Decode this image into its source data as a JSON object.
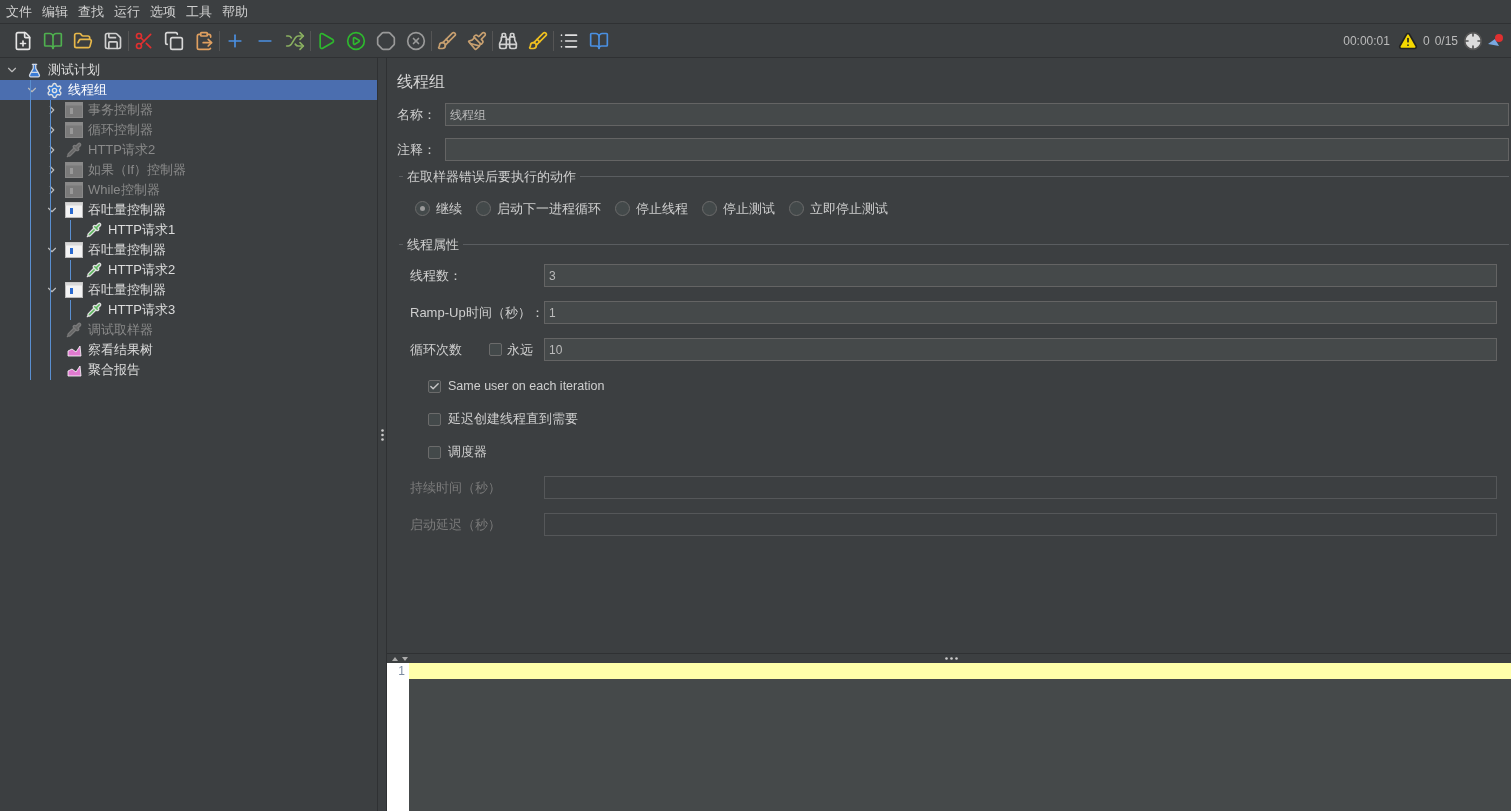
{
  "menu": [
    "文件",
    "编辑",
    "查找",
    "运行",
    "选项",
    "工具",
    "帮助"
  ],
  "status": {
    "elapsed": "00:00:01",
    "warnings": "0",
    "threads": "0/15"
  },
  "tree": [
    {
      "label": "测试计划",
      "kind": "plan",
      "expanded": true,
      "selected": false,
      "disabled": false,
      "children": [
        {
          "label": "线程组",
          "kind": "thread_group",
          "expanded": true,
          "selected": true,
          "disabled": false,
          "children": [
            {
              "label": "事务控制器",
              "kind": "controller",
              "expanded": false,
              "selected": false,
              "disabled": true
            },
            {
              "label": "循环控制器",
              "kind": "controller",
              "expanded": false,
              "selected": false,
              "disabled": true
            },
            {
              "label": "HTTP请求2",
              "kind": "sampler",
              "expanded": false,
              "selected": false,
              "disabled": true
            },
            {
              "label": "如果（If）控制器",
              "kind": "controller",
              "expanded": false,
              "selected": false,
              "disabled": true
            },
            {
              "label": "While控制器",
              "kind": "controller",
              "expanded": false,
              "selected": false,
              "disabled": true
            },
            {
              "label": "吞吐量控制器",
              "kind": "throughput",
              "expanded": true,
              "selected": false,
              "disabled": false,
              "children": [
                {
                  "label": "HTTP请求1",
                  "kind": "sampler",
                  "selected": false,
                  "disabled": false
                }
              ]
            },
            {
              "label": "吞吐量控制器",
              "kind": "throughput",
              "expanded": true,
              "selected": false,
              "disabled": false,
              "children": [
                {
                  "label": "HTTP请求2",
                  "kind": "sampler",
                  "selected": false,
                  "disabled": false
                }
              ]
            },
            {
              "label": "吞吐量控制器",
              "kind": "throughput",
              "expanded": true,
              "selected": false,
              "disabled": false,
              "children": [
                {
                  "label": "HTTP请求3",
                  "kind": "sampler",
                  "selected": false,
                  "disabled": false
                }
              ]
            },
            {
              "label": "调试取样器",
              "kind": "sampler",
              "selected": false,
              "disabled": true
            },
            {
              "label": "察看结果树",
              "kind": "listener",
              "selected": false,
              "disabled": false
            },
            {
              "label": "聚合报告",
              "kind": "listener",
              "selected": false,
              "disabled": false
            }
          ]
        }
      ]
    }
  ],
  "panel": {
    "title": "线程组",
    "name": {
      "label": "名称：",
      "value": "线程组"
    },
    "comment": {
      "label": "注释："
    },
    "error_action": {
      "legend": "在取样器错误后要执行的动作",
      "options": [
        {
          "label": "继续",
          "selected": true
        },
        {
          "label": "启动下一进程循环",
          "selected": false
        },
        {
          "label": "停止线程",
          "selected": false
        },
        {
          "label": "停止测试",
          "selected": false
        },
        {
          "label": "立即停止测试",
          "selected": false
        }
      ]
    },
    "thread_properties": {
      "legend": "线程属性",
      "threads": {
        "label": "线程数：",
        "value": "3"
      },
      "ramp_up": {
        "label": "Ramp-Up时间（秒）：",
        "value": "1"
      },
      "loop": {
        "label": "循环次数",
        "forever": {
          "label": "永远",
          "checked": false
        },
        "value": "10"
      },
      "options": [
        {
          "label": "Same user on each iteration",
          "checked": true
        },
        {
          "label": "延迟创建线程直到需要",
          "checked": false
        },
        {
          "label": "调度器",
          "checked": false
        }
      ],
      "scheduler_fields": [
        {
          "label": "持续时间（秒）",
          "disabled": true
        },
        {
          "label": "启动延迟（秒）",
          "disabled": true
        }
      ]
    }
  },
  "editor": {
    "line_numbers": [
      "1"
    ]
  }
}
